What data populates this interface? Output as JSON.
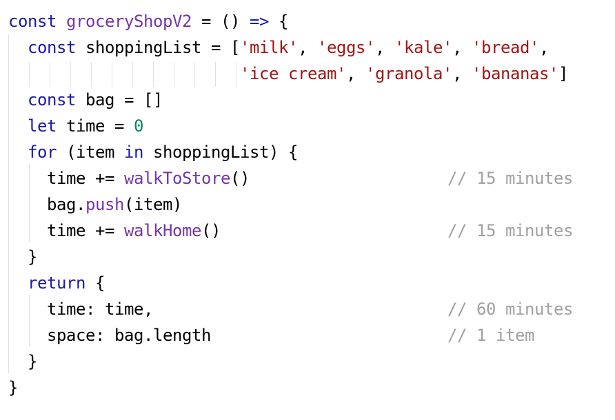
{
  "colors": {
    "keyword": "#1a1aa6",
    "function": "#7436a8",
    "string": "#a31515",
    "number": "#098658",
    "comment": "#a0a0a0",
    "plain": "#000000",
    "guide": "#e1e1e1"
  },
  "code": {
    "lines": [
      [
        {
          "text": "const",
          "kind": "keyword"
        },
        {
          "text": " ",
          "kind": "plain"
        },
        {
          "text": "groceryShopV2",
          "kind": "function"
        },
        {
          "text": " = () ",
          "kind": "plain"
        },
        {
          "text": "=>",
          "kind": "keyword"
        },
        {
          "text": " {",
          "kind": "plain"
        }
      ],
      [
        {
          "text": "  ",
          "kind": "plain"
        },
        {
          "text": "const",
          "kind": "keyword"
        },
        {
          "text": " shoppingList = [",
          "kind": "plain"
        },
        {
          "text": "'milk'",
          "kind": "string"
        },
        {
          "text": ", ",
          "kind": "plain"
        },
        {
          "text": "'eggs'",
          "kind": "string"
        },
        {
          "text": ", ",
          "kind": "plain"
        },
        {
          "text": "'kale'",
          "kind": "string"
        },
        {
          "text": ", ",
          "kind": "plain"
        },
        {
          "text": "'bread'",
          "kind": "string"
        },
        {
          "text": ",",
          "kind": "plain"
        }
      ],
      [
        {
          "text": "                        ",
          "kind": "plain"
        },
        {
          "text": "'ice cream'",
          "kind": "string"
        },
        {
          "text": ", ",
          "kind": "plain"
        },
        {
          "text": "'granola'",
          "kind": "string"
        },
        {
          "text": ", ",
          "kind": "plain"
        },
        {
          "text": "'bananas'",
          "kind": "string"
        },
        {
          "text": "]",
          "kind": "plain"
        }
      ],
      [
        {
          "text": "  ",
          "kind": "plain"
        },
        {
          "text": "const",
          "kind": "keyword"
        },
        {
          "text": " bag = []",
          "kind": "plain"
        }
      ],
      [
        {
          "text": "  ",
          "kind": "plain"
        },
        {
          "text": "let",
          "kind": "keyword"
        },
        {
          "text": " time = ",
          "kind": "plain"
        },
        {
          "text": "0",
          "kind": "number"
        }
      ],
      [
        {
          "text": "  ",
          "kind": "plain"
        },
        {
          "text": "for",
          "kind": "keyword"
        },
        {
          "text": " (item ",
          "kind": "plain"
        },
        {
          "text": "in",
          "kind": "keyword"
        },
        {
          "text": " shoppingList) {",
          "kind": "plain"
        }
      ],
      [
        {
          "text": "    time += ",
          "kind": "plain"
        },
        {
          "text": "walkToStore",
          "kind": "function"
        },
        {
          "text": "()",
          "kind": "plain"
        }
      ],
      [
        {
          "text": "    bag.",
          "kind": "plain"
        },
        {
          "text": "push",
          "kind": "function"
        },
        {
          "text": "(item)",
          "kind": "plain"
        }
      ],
      [
        {
          "text": "    time += ",
          "kind": "plain"
        },
        {
          "text": "walkHome",
          "kind": "function"
        },
        {
          "text": "()",
          "kind": "plain"
        }
      ],
      [
        {
          "text": "  }",
          "kind": "plain"
        }
      ],
      [
        {
          "text": "  ",
          "kind": "plain"
        },
        {
          "text": "return",
          "kind": "keyword"
        },
        {
          "text": " {",
          "kind": "plain"
        }
      ],
      [
        {
          "text": "    time: time,",
          "kind": "plain"
        }
      ],
      [
        {
          "text": "    space: bag.length",
          "kind": "plain"
        }
      ],
      [
        {
          "text": "  }",
          "kind": "plain"
        }
      ],
      [
        {
          "text": "}",
          "kind": "plain"
        }
      ]
    ],
    "comments": [
      {
        "line": 6,
        "text": "// 15 minutes"
      },
      {
        "line": 8,
        "text": "// 15 minutes"
      },
      {
        "line": 11,
        "text": "// 60 minutes"
      },
      {
        "line": 12,
        "text": "// 1 item"
      }
    ]
  }
}
